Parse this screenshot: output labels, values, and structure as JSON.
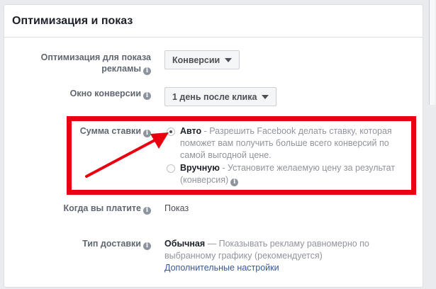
{
  "panel": {
    "title": "Оптимизация и показ"
  },
  "optimization": {
    "label_line1": "Оптимизация для показа",
    "label_line2": "рекламы",
    "dropdown_value": "Конверсии"
  },
  "conversion_window": {
    "label": "Окно конверсии",
    "dropdown_value": "1 день после клика"
  },
  "bid": {
    "label": "Сумма ставки",
    "auto": {
      "title": "Авто",
      "line1": " - Разрешить Facebook делать ставку, которая",
      "line2": "поможет вам получить больше всего конверсий по",
      "line3": "самой выгодной цене."
    },
    "manual": {
      "title": "Вручную",
      "line1": " - Установите желаемую цену за результат",
      "line2": "(конверсия)"
    }
  },
  "payment": {
    "label": "Когда вы платите",
    "value": "Показ"
  },
  "delivery": {
    "label": "Тип доставки",
    "title": "Обычная",
    "line1": " — Показывать рекламу равномерно по",
    "line2": "выбранному графику (рекомендуется)",
    "link": "Дополнительные настройки"
  },
  "icons": {
    "info": "info-icon",
    "caret": "caret-down-icon",
    "arrow": "red-arrow-annotation"
  },
  "colors": {
    "highlight": "#e8000f",
    "link": "#385898",
    "background": "#e9ebee"
  }
}
